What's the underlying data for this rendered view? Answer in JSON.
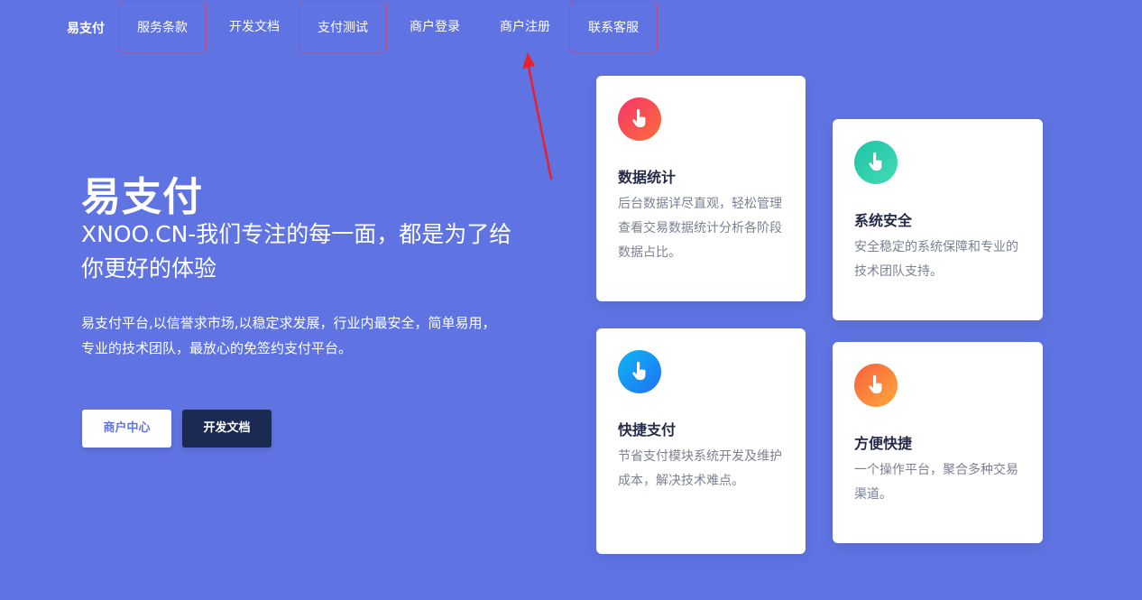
{
  "nav": {
    "brand": "易支付",
    "items": [
      {
        "label": "服务条款",
        "highlighted": true
      },
      {
        "label": "开发文档",
        "highlighted": false
      },
      {
        "label": "支付测试",
        "highlighted": true
      },
      {
        "label": "商户登录",
        "highlighted": false
      },
      {
        "label": "商户注册",
        "highlighted": false
      },
      {
        "label": "联系客服",
        "highlighted": true
      }
    ]
  },
  "hero": {
    "title": "易支付",
    "subtitle": "XNOO.CN-我们专注的每一面，都是为了给你更好的体验",
    "description": "易支付平台,以信誉求市场,以稳定求发展，行业内最安全，简单易用，专业的技术团队，最放心的免签约支付平台。",
    "primary_button": "商户中心",
    "secondary_button": "开发文档"
  },
  "features": [
    {
      "title": "数据统计",
      "description": "后台数据详尽直观，轻松管理查看交易数据统计分析各阶段数据占比。",
      "icon": "hand-pointer-icon",
      "gradient": [
        "#f7346b",
        "#fc6e3b"
      ]
    },
    {
      "title": "系统安全",
      "description": "安全稳定的系统保障和专业的技术团队支持。",
      "icon": "hand-pointer-icon",
      "gradient": [
        "#1ec3a4",
        "#43dcb6"
      ]
    },
    {
      "title": "快捷支付",
      "description": "节省支付模块系统开发及维护成本，解决技术难点。",
      "icon": "hand-pointer-icon",
      "gradient": [
        "#0fb5f4",
        "#1f72f3"
      ]
    },
    {
      "title": "方便快捷",
      "description": "一个操作平台，聚合多种交易渠道。",
      "icon": "hand-pointer-icon",
      "gradient": [
        "#fb5f3d",
        "#fcaa3a"
      ]
    }
  ],
  "colors": {
    "background": "#5f74e2",
    "dark_button": "#1a2a52",
    "highlight_border": "#e8324c",
    "annotation_arrow": "#e8202c"
  }
}
